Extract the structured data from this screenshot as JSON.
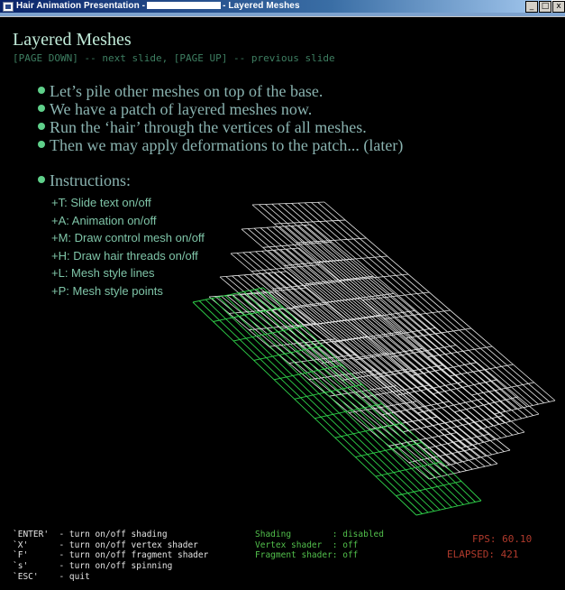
{
  "window": {
    "title_prefix": "Hair Animation Presentation -",
    "title_suffix": "- Layered Meshes",
    "controls": {
      "minimize": "_",
      "maximize": "□",
      "close": "x"
    }
  },
  "slide": {
    "title": "Layered Meshes",
    "nav_hint": "[PAGE DOWN] -- next slide, [PAGE UP] -- previous slide",
    "bullets": [
      "Let’s pile other meshes on top of the base.",
      "We have a patch of layered meshes now.",
      "Run the ‘hair’ through the vertices of all meshes.",
      "Then we may apply deformations to the patch... (later)"
    ],
    "instructions_title": "Instructions:",
    "instructions": [
      "+T: Slide text on/off",
      "+A: Animation on/off",
      "+M: Draw control mesh on/off",
      "+H: Draw hair threads on/off",
      "+L: Mesh style lines",
      "+P: Mesh style points"
    ]
  },
  "keys": [
    "`ENTER'  - turn on/off shading",
    "`X'      - turn on/off vertex shader",
    "`F'      - turn on/off fragment shader",
    "`s'      - turn on/off spinning",
    "`ESC'    - quit"
  ],
  "status": [
    "Shading        : disabled",
    "Vertex shader  : off",
    "Fragment shader: off"
  ],
  "fps": "FPS: 60.10",
  "elapsed": "ELAPSED: 421",
  "colors": {
    "mesh_base": "#2fd24a",
    "mesh_layers": "#e8e8e8",
    "bullet_dot": "#5fd08a",
    "fps_text": "#b03a2c"
  }
}
